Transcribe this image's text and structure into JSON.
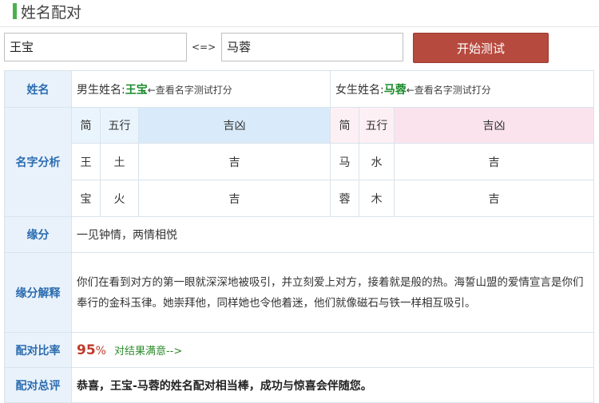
{
  "header": {
    "title": "姓名配对"
  },
  "form": {
    "male_name": "王宝",
    "separator": "<=>",
    "female_name": "马蓉",
    "submit_label": "开始测试"
  },
  "result": {
    "name_row": {
      "label": "姓名",
      "male_prefix": "男生姓名:",
      "male_name": "王宝",
      "male_hint": "←查看名字测试打分",
      "female_prefix": "女生姓名:",
      "female_name": "马蓉",
      "female_hint": "←查看名字测试打分"
    },
    "analysis": {
      "label": "名字分析",
      "headers": [
        "简",
        "五行",
        "吉凶"
      ],
      "male_chars": [
        {
          "char": "王",
          "element": "土",
          "luck": "吉"
        },
        {
          "char": "宝",
          "element": "火",
          "luck": "吉"
        }
      ],
      "female_chars": [
        {
          "char": "马",
          "element": "水",
          "luck": "吉"
        },
        {
          "char": "蓉",
          "element": "木",
          "luck": "吉"
        }
      ]
    },
    "fate": {
      "label": "缘分",
      "text": "一见钟情，两情相悦"
    },
    "explanation": {
      "label": "缘分解释",
      "text": "你们在看到对方的第一眼就深深地被吸引，并立刻爱上对方，接着就是般的热。海誓山盟的爱情宣言是你们奉行的金科玉律。她崇拜他，同样她也令他着迷，他们就像磁石与铁一样相互吸引。"
    },
    "ratio": {
      "label": "配对比率",
      "value": "95",
      "unit": "%",
      "satisfied": "对结果满意-->"
    },
    "summary": {
      "label": "配对总评",
      "text": "恭喜，王宝-马蓉的姓名配对相当棒，成功与惊喜会伴随您。"
    }
  }
}
